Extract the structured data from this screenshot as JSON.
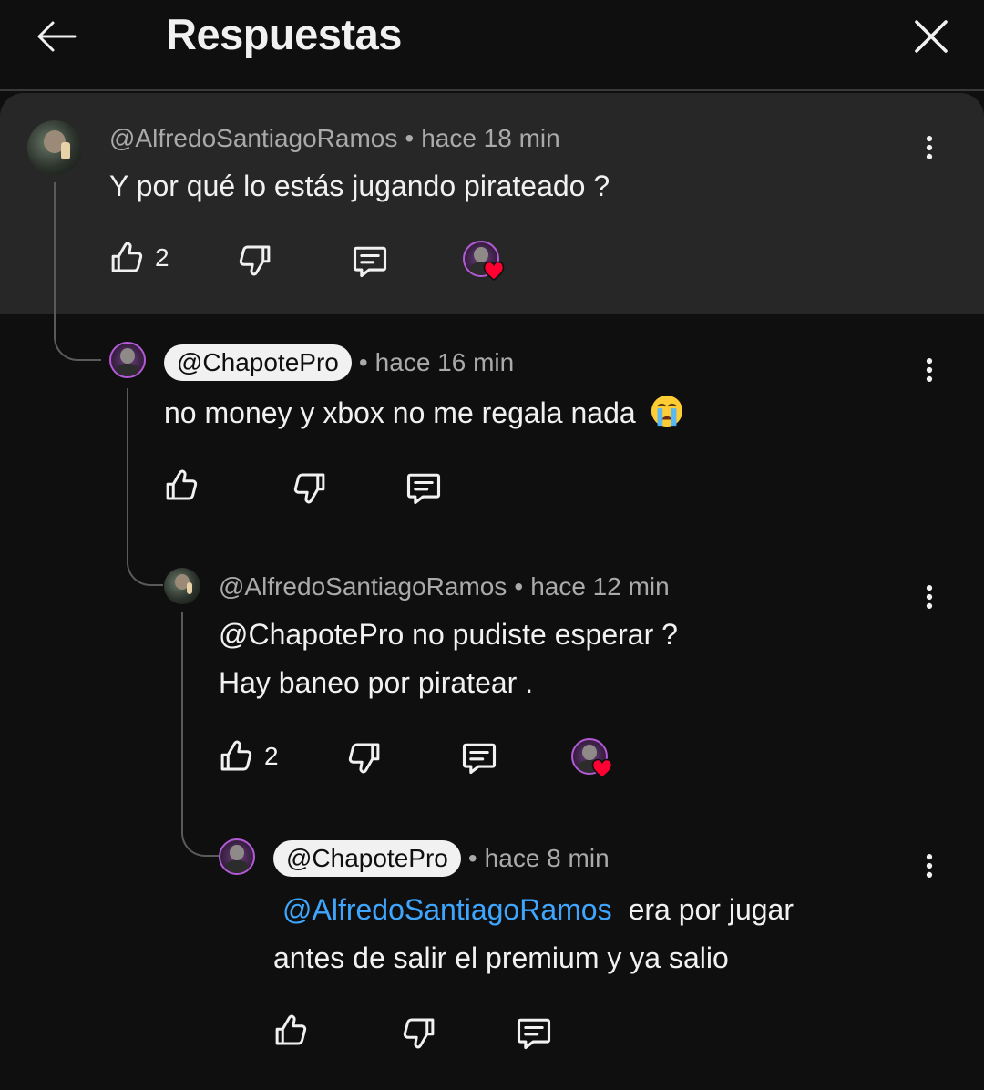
{
  "header": {
    "title": "Respuestas"
  },
  "comments": [
    {
      "author": "@AlfredoSantiagoRamos",
      "time": "hace 18 min",
      "lines": [
        "Y por qué lo estás jugando pirateado ?"
      ],
      "likes": "2",
      "hearted": true
    },
    {
      "author": "@ChapotePro",
      "time": "hace 16 min",
      "lines": [
        "no money y  xbox no me regala nada"
      ],
      "likes": "",
      "hearted": false
    },
    {
      "author": "@AlfredoSantiagoRamos",
      "time": "hace 12 min",
      "lines": [
        "@ChapotePro no pudiste esperar ?",
        "Hay baneo por piratear ."
      ],
      "likes": "2",
      "hearted": true
    },
    {
      "author": "@ChapotePro",
      "time": "hace 8 min",
      "mention": "@AlfredoSantiagoRamos",
      "lines": [
        "era por jugar",
        "antes de salir el premium y ya salio"
      ],
      "likes": "",
      "hearted": false
    }
  ],
  "meta_separator": "•",
  "icons": {
    "back": "back-arrow-icon",
    "close": "close-icon",
    "like": "thumbs-up-icon",
    "dislike": "thumbs-down-icon",
    "reply": "reply-icon",
    "menu": "more-vert-icon",
    "heart": "heart-icon",
    "emoji": "crying-face-emoji"
  },
  "colors": {
    "background": "#0f0f0f",
    "highlight": "#272727",
    "text": "#f1f1f1",
    "meta": "#aaaaaa",
    "mention": "#3ea6ff",
    "heart": "#ff0033"
  }
}
